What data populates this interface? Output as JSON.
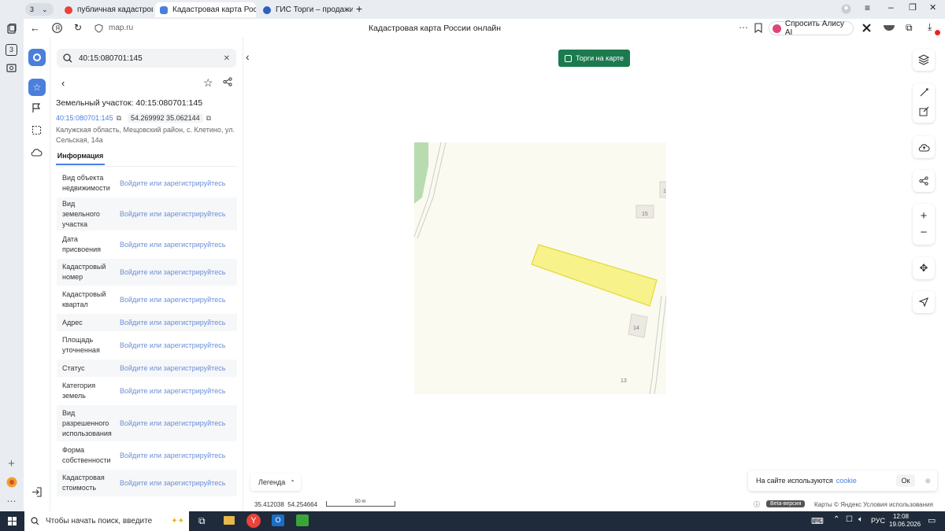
{
  "browser": {
    "tab_count": "3",
    "tabs": [
      {
        "title": "публичная кадастровая к",
        "color": "#e8443a"
      },
      {
        "title": "Кадастровая карта Рос",
        "color": "#4a7fdc"
      },
      {
        "title": "ГИС Торги – продажи гос",
        "color": "#2d5fc4"
      }
    ],
    "url": "map.ru",
    "page_title": "Кадастровая карта России онлайн",
    "alice_label": "Спросить Алису AI"
  },
  "search": {
    "value": "40:15:080701:145"
  },
  "object": {
    "title": "Земельный участок: 40:15:080701:145",
    "cadnum": "40:15:080701:145",
    "coords": "54.269992 35.062144",
    "address": "Калужская область, Мещовский район, с. Клетино, ул. Сельская, 14а"
  },
  "tabs": {
    "info": "Информация"
  },
  "info_rows": [
    {
      "label": "Вид объекта недвижимости",
      "value": "Войдите или зарегистрируйтесь"
    },
    {
      "label": "Вид земельного участка",
      "value": "Войдите или зарегистрируйтесь"
    },
    {
      "label": "Дата присвоения",
      "value": "Войдите или зарегистрируйтесь"
    },
    {
      "label": "Кадастровый номер",
      "value": "Войдите или зарегистрируйтесь"
    },
    {
      "label": "Кадастровый квартал",
      "value": "Войдите или зарегистрируйтесь"
    },
    {
      "label": "Адрес",
      "value": "Войдите или зарегистрируйтесь"
    },
    {
      "label": "Площадь уточненная",
      "value": "Войдите или зарегистрируйтесь"
    },
    {
      "label": "Статус",
      "value": "Войдите или зарегистрируйтесь"
    },
    {
      "label": "Категория земель",
      "value": "Войдите или зарегистрируйтесь"
    },
    {
      "label": "Вид разрешенного использования",
      "value": "Войдите или зарегистрируйтесь"
    },
    {
      "label": "Форма собственности",
      "value": "Войдите или зарегистрируйтесь"
    },
    {
      "label": "Кадастровая стоимость",
      "value": "Войдите или зарегистрируйтесь"
    }
  ],
  "map": {
    "torgi_label": "Торги на карте",
    "house_numbers": [
      "15",
      "14",
      "13",
      "1"
    ],
    "legend_label": "Легенда",
    "coords": "35.412038  54.254664",
    "scale_label": "50 m",
    "beta_label": "Beta-версия",
    "copyright": "Карты © Яндекс",
    "terms": "Условия использования",
    "cookie_text": "На сайте используются",
    "cookie_link": "cookie",
    "cookie_ok": "Ок"
  },
  "taskbar": {
    "search_placeholder": "Чтобы начать поиск, введите",
    "lang": "РУС",
    "time": "12:08",
    "date": "19.06.2026"
  },
  "colors": {
    "parcel_fill": "#f7f28a",
    "parcel_stroke": "#e5d83a",
    "torgi_bg": "#1d7a4f",
    "link": "#4a7fdc"
  }
}
